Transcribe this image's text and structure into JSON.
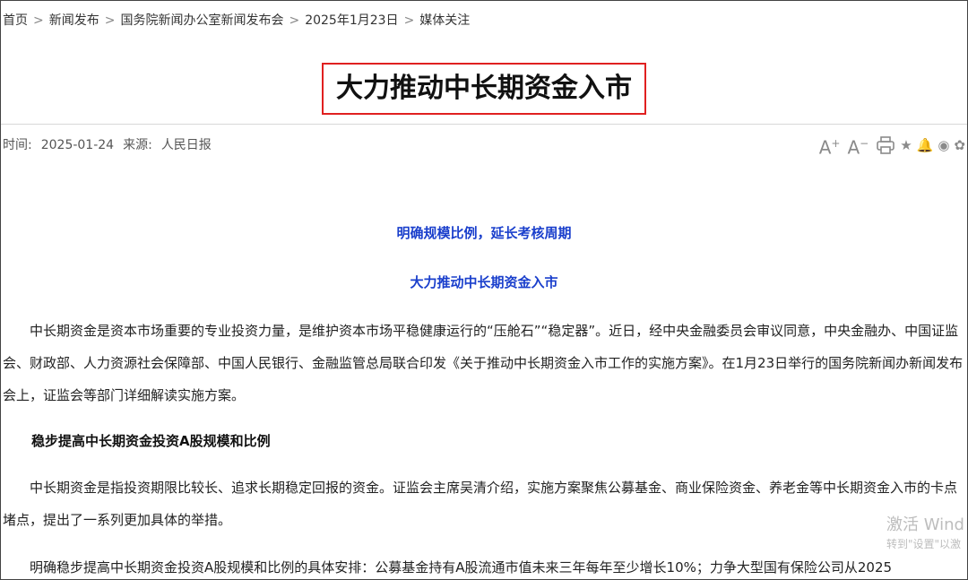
{
  "breadcrumb": {
    "items": [
      "首页",
      "新闻发布",
      "国务院新闻办公室新闻发布会",
      "2025年1月23日",
      "媒体关注"
    ],
    "separator": ">"
  },
  "article": {
    "title": "大力推动中长期资金入市",
    "time_label": "时间:",
    "time_value": "2025-01-24",
    "source_label": "来源:",
    "source_value": "人民日报",
    "subtitle1": "明确规模比例，延长考核周期",
    "subtitle2": "大力推动中长期资金入市",
    "para1": "中长期资金是资本市场重要的专业投资力量，是维护资本市场平稳健康运行的“压舱石”“稳定器”。近日，经中央金融委员会审议同意，中央金融办、中国证监会、财政部、人力资源社会保障部、中国人民银行、金融监管总局联合印发《关于推动中长期资金入市工作的实施方案》。在1月23日举行的国务院新闻办新闻发布会上，证监会等部门详细解读实施方案。",
    "heading1": "稳步提高中长期资金投资A股规模和比例",
    "para2": "中长期资金是指投资期限比较长、追求长期稳定回报的资金。证监会主席吴清介绍，实施方案聚焦公募基金、商业保险资金、养老金等中长期资金入市的卡点堵点，提出了一系列更加具体的举措。",
    "para3": "明确稳步提高中长期资金投资A股规模和比例的具体安排：公募基金持有A股流通市值未来三年每年至少增长10%；力争大型国有保险公司从2025"
  },
  "tools": {
    "font_up": "A",
    "font_up_sup": "+",
    "font_down": "A",
    "font_down_sup": "−",
    "star": "★",
    "bell": "🔔",
    "weibo": "◉",
    "wechat": "✿"
  },
  "watermark": {
    "line1": "激活 Wind",
    "line2": "转到\"设置\"以激"
  },
  "colors": {
    "title_border": "#e02020",
    "subtitle": "#1a3fcc"
  }
}
